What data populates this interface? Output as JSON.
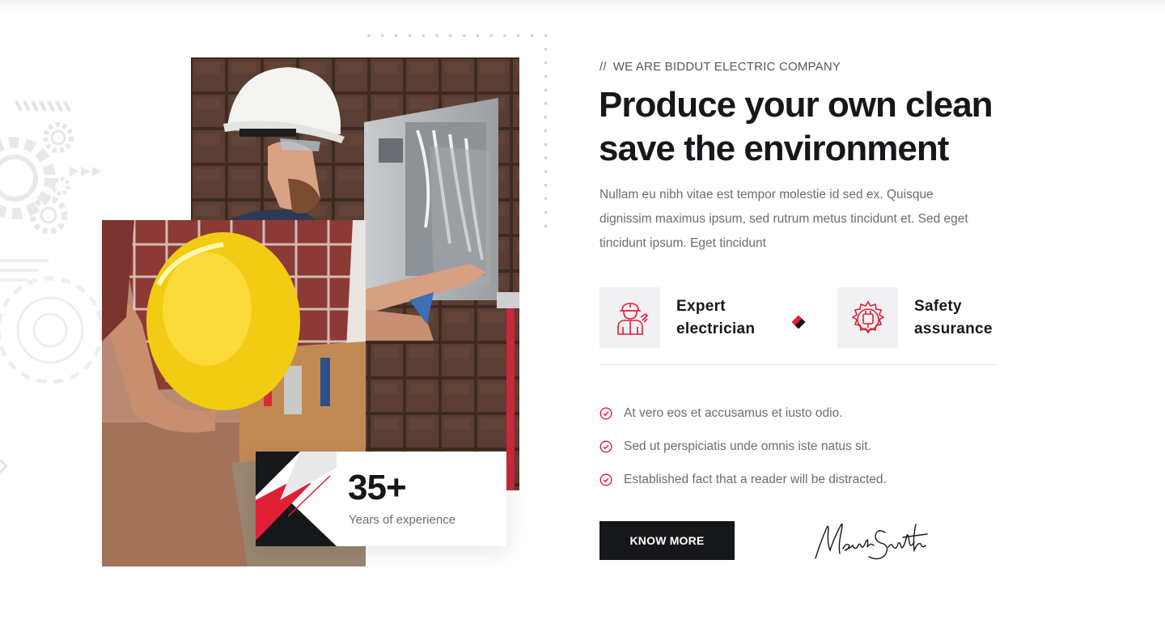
{
  "section": {
    "eyebrow_slashes": "//",
    "eyebrow": "WE ARE BIDDUT ELECTRIC COMPANY",
    "headline_line1": "Produce your own clean",
    "headline_line2": "save the environment",
    "intro": "Nullam eu nibh vitae est tempor molestie id sed ex. Quisque dignissim maximus ipsum, sed rutrum metus tincidunt et. Sed eget tincidunt ipsum. Eget tincidunt"
  },
  "features": [
    {
      "line1": "Expert",
      "line2": "electrician",
      "icon": "electrician-icon"
    },
    {
      "line1": "Safety",
      "line2": "assurance",
      "icon": "safety-gear-icon"
    }
  ],
  "checklist": [
    "At vero eos et accusamus et iusto odio.",
    "Sed ut perspiciatis unde omnis iste natus sit.",
    "Established fact that a reader will be distracted."
  ],
  "experience": {
    "number": "35+",
    "label": "Years of experience"
  },
  "cta": {
    "label": "KNOW MORE"
  },
  "signature": {
    "text": "Mark Smith"
  },
  "colors": {
    "accent": "#e01f35",
    "dark": "#16171a",
    "muted": "#6b6d72",
    "icon_bg": "#f1f1f3"
  }
}
